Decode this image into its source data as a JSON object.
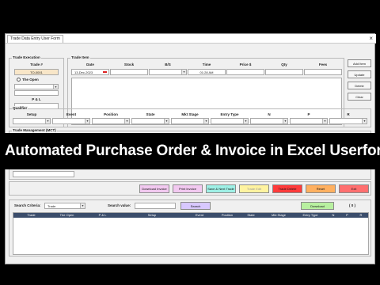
{
  "window": {
    "tab_label": "Trade Data Entry User Form",
    "close_glyph": "×"
  },
  "trade_execution": {
    "caption": "Trade Execution",
    "trade_no_label": "Trade #",
    "trade_no_value": "TO-0001",
    "the_open_label": "The Open",
    "pl_label": "P & L"
  },
  "trade_item": {
    "caption": "Trade Item",
    "columns": [
      "Date",
      "Stock",
      "B/S",
      "Time",
      "Price $",
      "Qty",
      "Fees"
    ],
    "date_value": "13-Dec-2023",
    "time_value": "01:28 AM"
  },
  "side_buttons": [
    "Add Item",
    "Update",
    "Delete",
    "Clear"
  ],
  "qualifier": {
    "caption": "Qualifier",
    "columns": [
      "Setup",
      "Event",
      "Position",
      "State",
      "Mkt Stage",
      "Entry Type",
      "N",
      "P",
      "R"
    ]
  },
  "trade_management": {
    "caption": "Trade Management (MCT)"
  },
  "banner": {
    "text": "Automated Purchase Order & Invoice in Excel Userform"
  },
  "action_buttons": [
    {
      "label": "Download Invoice",
      "color": "#f2c9f0"
    },
    {
      "label": "Print Invoice",
      "color": "#f2c9f0"
    },
    {
      "label": "Save & Next Trade",
      "color": "#9ff0e6"
    },
    {
      "label": "Trade Edit",
      "color": "#fff3a0"
    },
    {
      "label": "Trade Delete",
      "color": "#ff3b3b"
    },
    {
      "label": "Reset",
      "color": "#ffb060"
    },
    {
      "label": "Exit",
      "color": "#ff6f6f"
    }
  ],
  "search": {
    "criteria_label": "Search Criteria:",
    "criteria_value": "Trade",
    "value_label": "Search value:",
    "search_button": "Search",
    "download_button": "Download",
    "count": "( 0 )"
  },
  "results_table": {
    "columns": [
      "Trade",
      "The Open",
      "P & L",
      "Setup",
      "Event",
      "Position",
      "State",
      "Mkt Stage",
      "Entry Type",
      "N",
      "P",
      "R"
    ]
  }
}
